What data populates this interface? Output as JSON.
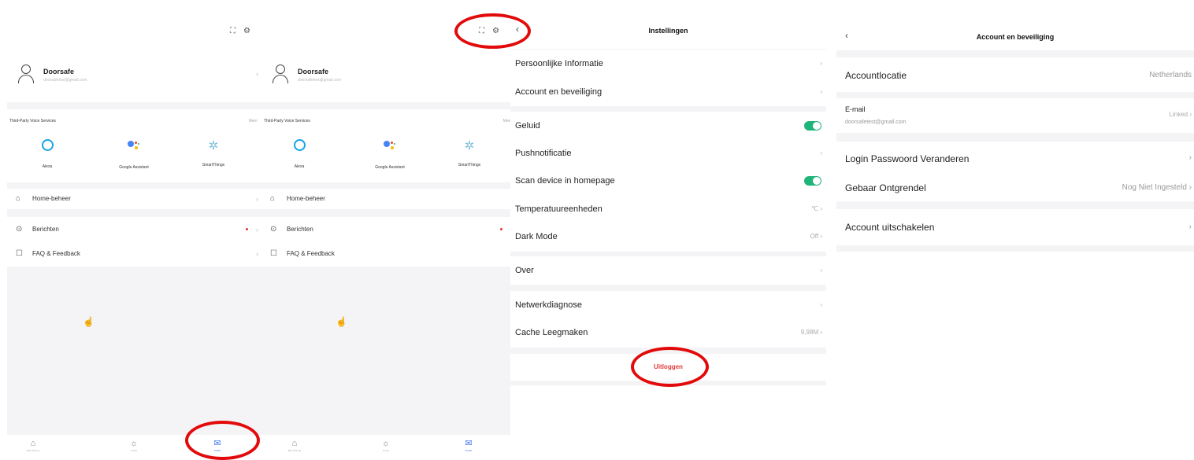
{
  "profile": {
    "user_name": "Doorsafe",
    "user_email": "doorsafetest@gmail.com",
    "voice_title": "Third-Party Voice Services",
    "voice_more": "Meer",
    "services": [
      {
        "label": "Alexa",
        "icon": "alexa-icon"
      },
      {
        "label": "Google Assistant",
        "icon": "google-assistant-icon"
      },
      {
        "label": "SmartThings",
        "icon": "smartthings-icon"
      }
    ],
    "menu": {
      "home": "Home-beheer",
      "messages": "Berichten",
      "faq": "FAQ & Feedback"
    },
    "tabs": [
      {
        "label": "Mijn Woning",
        "icon": "home-icon"
      },
      {
        "label": "Smart",
        "icon": "smart-icon"
      },
      {
        "label": "Profiel",
        "icon": "profile-icon"
      }
    ]
  },
  "settings": {
    "title": "Instellingen",
    "items": [
      {
        "label": "Persoonlijke Informatie"
      },
      {
        "label": "Account en beveiliging"
      },
      {
        "label": "Geluid",
        "toggle": true
      },
      {
        "label": "Pushnotificatie"
      },
      {
        "label": "Scan device in homepage",
        "toggle": true
      },
      {
        "label": "Temperatuureenheden",
        "value": "℃"
      },
      {
        "label": "Dark Mode",
        "value": "Off"
      },
      {
        "label": "Over"
      },
      {
        "label": "Netwerkdiagnose"
      },
      {
        "label": "Cache Leegmaken",
        "value": "9,98M"
      }
    ],
    "logout": "Uitloggen"
  },
  "account": {
    "title": "Account en beveiliging",
    "location_label": "Accountlocatie",
    "location_value": "Netherlands",
    "email_label": "E-mail",
    "email_value": "doorsafetest@gmail.com",
    "email_status": "Linked",
    "password_label": "Login Passwoord Veranderen",
    "gesture_label": "Gebaar Ontgrendel",
    "gesture_value": "Nog Niet Ingesteld",
    "disable_label": "Account uitschakelen"
  },
  "colors": {
    "accent": "#3a6ff0",
    "toggle_on": "#1fb47a",
    "logout": "#e23b3b",
    "highlight_ring": "#e20a0a"
  }
}
